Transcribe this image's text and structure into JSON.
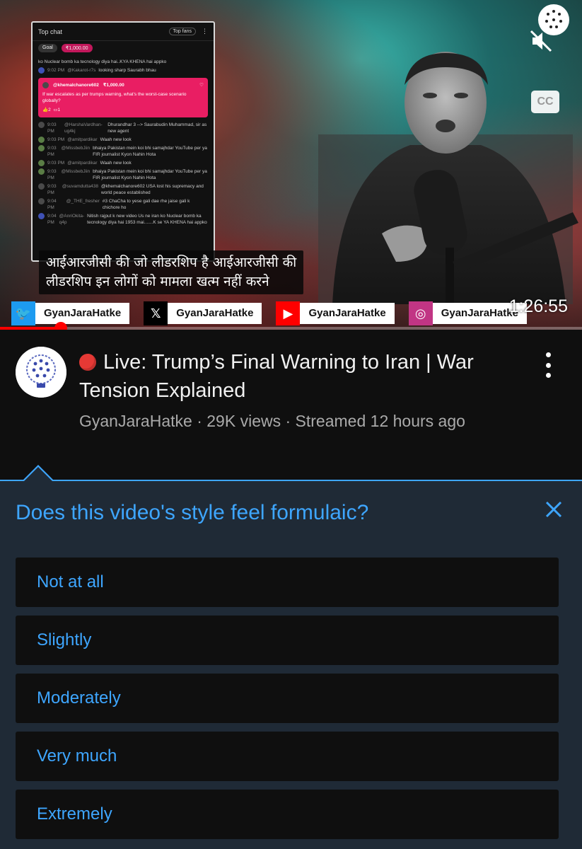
{
  "player": {
    "chat": {
      "header": "Top chat",
      "top_fans": "Top fans",
      "goal_label": "Goal",
      "goal_amount": "₹1,000.00",
      "first_line": "ko Nuclear bomb ka tecnology diya hai..KYA KHENA hai appko",
      "lines": [
        {
          "time": "9:02 PM",
          "user": "@Kakarot-r7s",
          "text": "looking sharp Saurabh bhau"
        },
        {
          "time": "9:03 PM",
          "user": "@HarshaVardhan-ug4kj",
          "text": "Dhurandhar 3 --> Saurabudin Muhammad, sir as new agent"
        },
        {
          "time": "9:03 PM",
          "user": "@amitpardikar",
          "text": "Waah new look"
        },
        {
          "time": "9:03 PM",
          "user": "@MissbebJiin",
          "text": "bhaiya Pakistan mein koi bhi samajhdar YouTube per ya FIR journalist Kyon Nahin Hota"
        },
        {
          "time": "9:03 PM",
          "user": "@amitpardikar",
          "text": "Waah new look"
        },
        {
          "time": "9:03 PM",
          "user": "@MissbebJiin",
          "text": "bhaiya Pakistan mein koi bhi samajhdar YouTube per ya FIR journalist Kyon Nahin Hota"
        },
        {
          "time": "9:03 PM",
          "user": "@suvamdutta438",
          "text": "@khemalchanore602 USA lost his supremacy and world peace established"
        },
        {
          "time": "9:04 PM",
          "user": "@_THE_fresher",
          "text": "#3 ChaCha to yese gali dae rhe jaise gali k chichore ho"
        },
        {
          "time": "9:04 PM",
          "user": "@AnriOkita-q4p",
          "text": "Nitish rajput k new video Us ne iran ko Nuclear bomb ka tecnology diya hai 1953 mai.......K se YA KHENA hai appko"
        }
      ],
      "superchat": {
        "user": "@khemalchanore602",
        "amount": "₹1,000.00",
        "text": "If war escalates as per trumps warning, what's the worst-case scenario globally?",
        "likes": "2",
        "replies": "1"
      }
    },
    "subtitle_line1": "आईआरजीसी की जो लीडरशिप है आईआरजीसी की",
    "subtitle_line2": "लीडरशिप इन लोगों को मामला खत्म नहीं करने",
    "cc_label": "CC",
    "socials": [
      {
        "icon": "twitter-icon",
        "name": "GyanJaraHatke",
        "color": "#1d9bf0"
      },
      {
        "icon": "x-icon",
        "name": "GyanJaraHatke",
        "color": "#000000"
      },
      {
        "icon": "youtube-icon",
        "name": "GyanJaraHatke",
        "color": "#ff0000"
      },
      {
        "icon": "instagram-icon",
        "name": "GyanJaraHatke",
        "color": "#c13584"
      }
    ],
    "duration": "1:26:55",
    "progress_fraction": 0.105
  },
  "video": {
    "title": "Live: Trump’s Final Warning to Iran | War Tension Explained",
    "channel": "GyanJaraHatke",
    "views": "29K views",
    "streamed": "Streamed 12 hours ago",
    "separator": " · "
  },
  "survey": {
    "question": "Does this video's style feel formulaic?",
    "options": [
      "Not at all",
      "Slightly",
      "Moderately",
      "Very much",
      "Extremely"
    ]
  },
  "colors": {
    "accent_blue": "#3ea6ff",
    "survey_bg": "#1f2a36",
    "page_bg": "#0f0f0f",
    "live_red": "#e53935"
  }
}
